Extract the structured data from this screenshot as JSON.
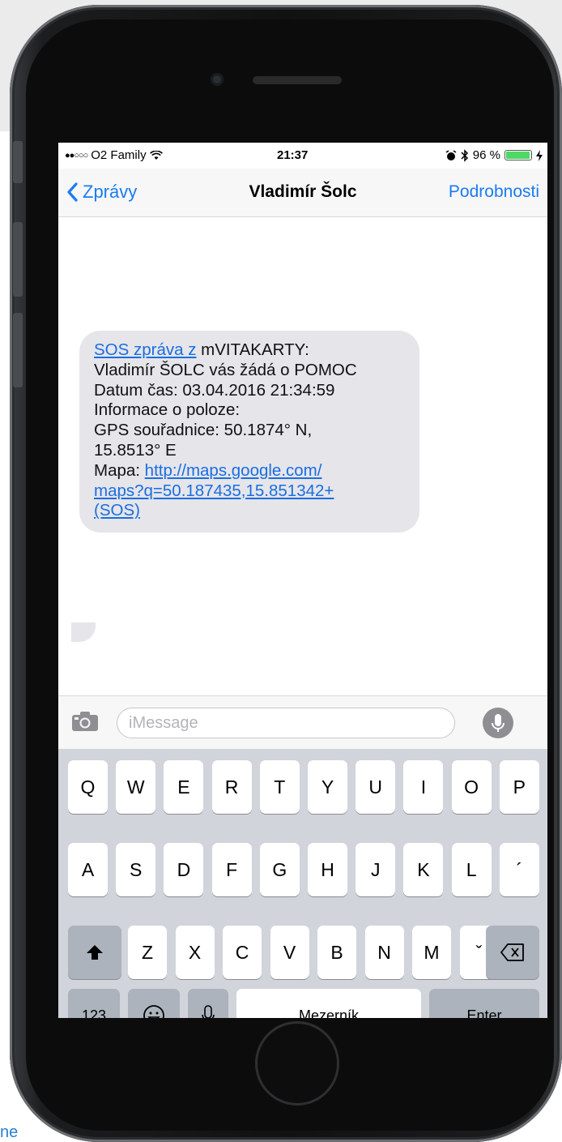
{
  "status_bar": {
    "carrier": "O2 Family",
    "time": "21:37",
    "battery_percent": "96 %",
    "battery_level": 0.96
  },
  "nav": {
    "back_label": "Zprávy",
    "title": "Vladimír Šolc",
    "details_label": "Podrobnosti"
  },
  "message": {
    "link_prefix": "SOS zpráva z",
    "line1_rest": " mVITAKARTY:",
    "line2": "Vladimír ŠOLC vás žádá o POMOC",
    "line3": "Datum čas: 03.04.2016 21:34:59",
    "line4": "Informace o poloze:",
    "line5": "GPS souřadnice: 50.1874° N,",
    "line6": "15.8513° E",
    "map_label": "Mapa: ",
    "map_link_part1": "http://maps.google.com/",
    "map_link_part2": "maps?q=50.187435,15.851342+",
    "map_link_part3": "(SOS)"
  },
  "input": {
    "placeholder": "iMessage"
  },
  "keyboard": {
    "row1": [
      "Q",
      "W",
      "E",
      "R",
      "T",
      "Y",
      "U",
      "I",
      "O",
      "P"
    ],
    "row2": [
      "A",
      "S",
      "D",
      "F",
      "G",
      "H",
      "J",
      "K",
      "L",
      "´"
    ],
    "row3": [
      "Z",
      "X",
      "C",
      "V",
      "B",
      "N",
      "M",
      "ˇ"
    ],
    "numbers_label": "123",
    "space_label": "Mezerník",
    "enter_label": "Enter"
  },
  "page_fragment": "ne",
  "colors": {
    "accent": "#1a7cf0",
    "bubble": "#e5e5ea",
    "battery": "#4cd964",
    "keyboard_bg": "#d1d4da"
  }
}
